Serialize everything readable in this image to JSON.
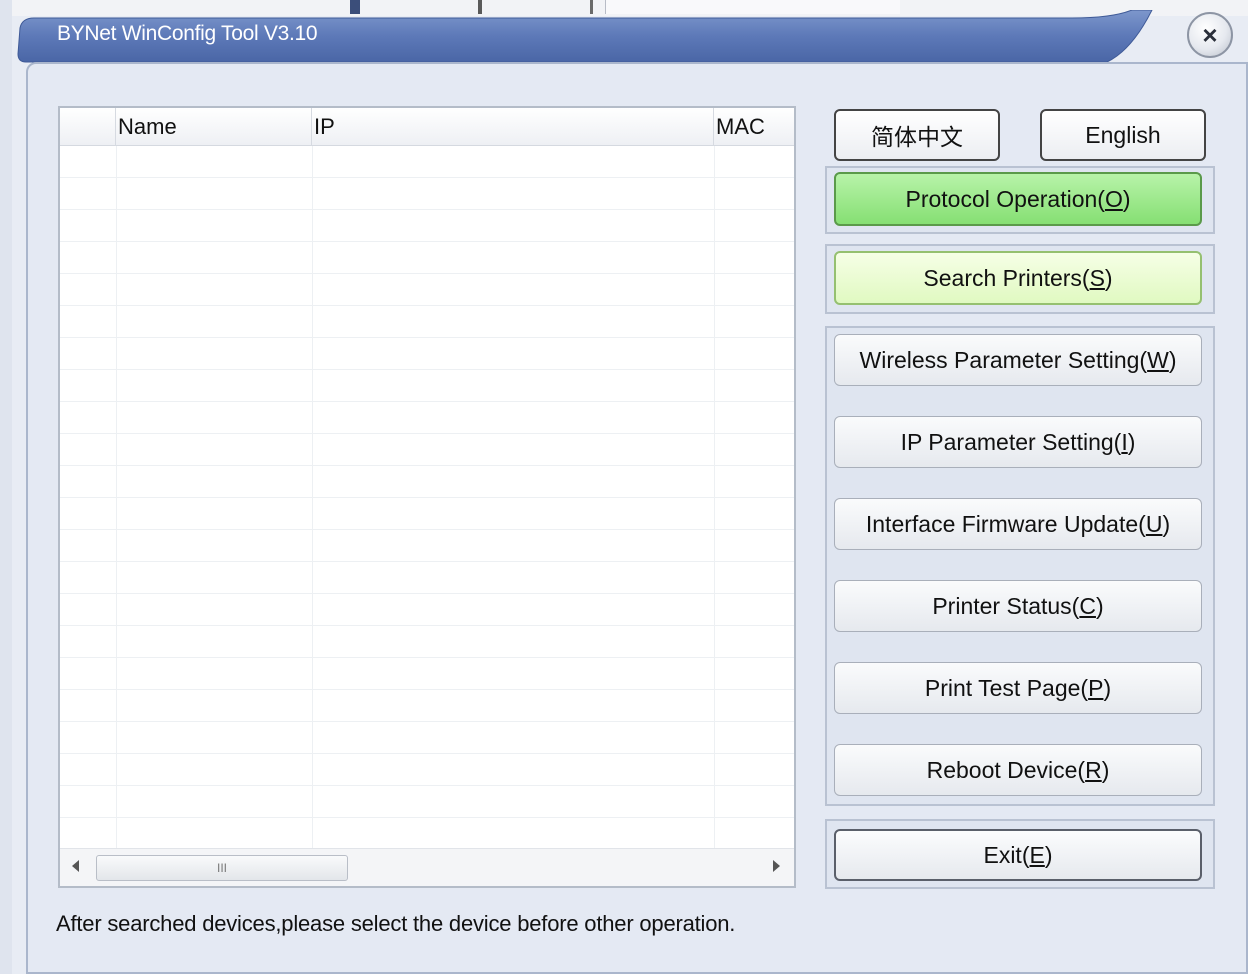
{
  "window": {
    "title": "BYNet WinConfig Tool V3.10",
    "close_glyph": "×"
  },
  "list": {
    "columns": [
      "",
      "Name",
      "IP",
      "MAC"
    ],
    "scroll_thumb_glyph": "III",
    "rows": []
  },
  "language": {
    "chinese_label": "简体中文",
    "english_label": "English"
  },
  "buttons": {
    "protocol_operation": {
      "text": "Protocol Operation(",
      "key": "O",
      "tail": ")"
    },
    "search_printers": {
      "text": "Search Printers(",
      "key": "S",
      "tail": ")"
    },
    "wireless_parameter": {
      "text": "Wireless Parameter Setting(",
      "key": "W",
      "tail": ")"
    },
    "ip_parameter": {
      "text": "IP Parameter Setting(",
      "key": "I",
      "tail": ")"
    },
    "firmware_update": {
      "text": "Interface Firmware Update(",
      "key": "U",
      "tail": ")"
    },
    "printer_status": {
      "text": "Printer Status(",
      "key": "C",
      "tail": ")"
    },
    "print_test_page": {
      "text": "Print Test Page(",
      "key": "P",
      "tail": ")"
    },
    "reboot_device": {
      "text": "Reboot Device(",
      "key": "R",
      "tail": ")"
    },
    "exit": {
      "text": "Exit(",
      "key": "E",
      "tail": ")"
    }
  },
  "status": {
    "message": "After searched devices,please select the device before other operation."
  },
  "colors": {
    "title_bar": "#5d79b8",
    "accent_green": "#86df73",
    "light_green": "#e0f9c1"
  }
}
